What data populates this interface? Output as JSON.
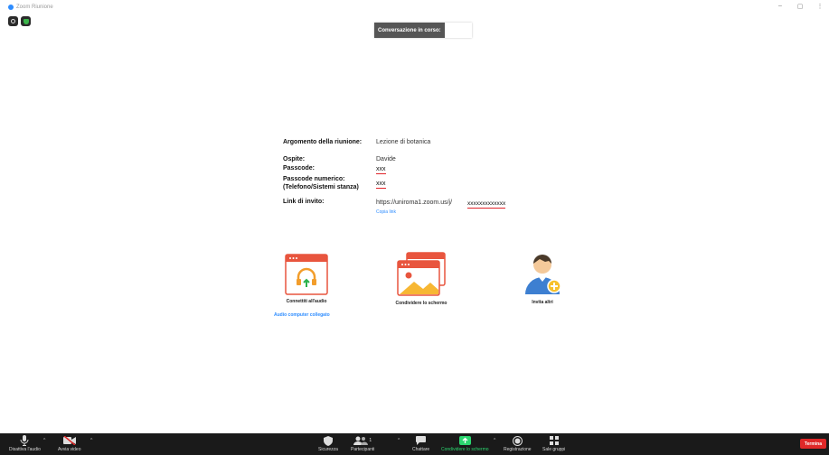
{
  "window": {
    "title": "Zoom Riunione",
    "controls": [
      "–",
      "▢",
      "⋮"
    ]
  },
  "banner": {
    "label": "Conversazione in corso:"
  },
  "meeting": {
    "topic_label": "Argomento della riunione:",
    "topic_value": "Lezione di botanica",
    "host_label": "Ospite:",
    "host_value": "Davide",
    "passcode_label": "Passcode:",
    "passcode_value": "xxx",
    "numeric_label_1": "Passcode numerico:",
    "numeric_label_2": "(Telefono/Sistemi stanza)",
    "numeric_value": "xxx",
    "invite_label": "Link di invito:",
    "invite_url": "https://uniroma1.zoom.us/j/",
    "invite_masked": "xxxxxxxxxxxxx",
    "copy_link": "Copia link"
  },
  "actions": {
    "audio": "Connettiti all'audio",
    "audio_status": "Audio computer collegato",
    "share": "Condividere lo schermo",
    "invite": "Invita altri"
  },
  "toolbar": {
    "mute": "Disattiva l'audio",
    "video": "Avvia video",
    "security": "Sicurezza",
    "participants": "Partecipanti",
    "participants_count": "1",
    "chat": "Chattare",
    "share": "Condividere lo schermo",
    "record": "Registrazione",
    "breakout": "Sale gruppi",
    "end": "Termina"
  },
  "colors": {
    "accent_blue": "#2d8cff",
    "share_green": "#2bd66f",
    "end_red": "#e02828",
    "toolbar_bg": "#1a1a1a"
  }
}
